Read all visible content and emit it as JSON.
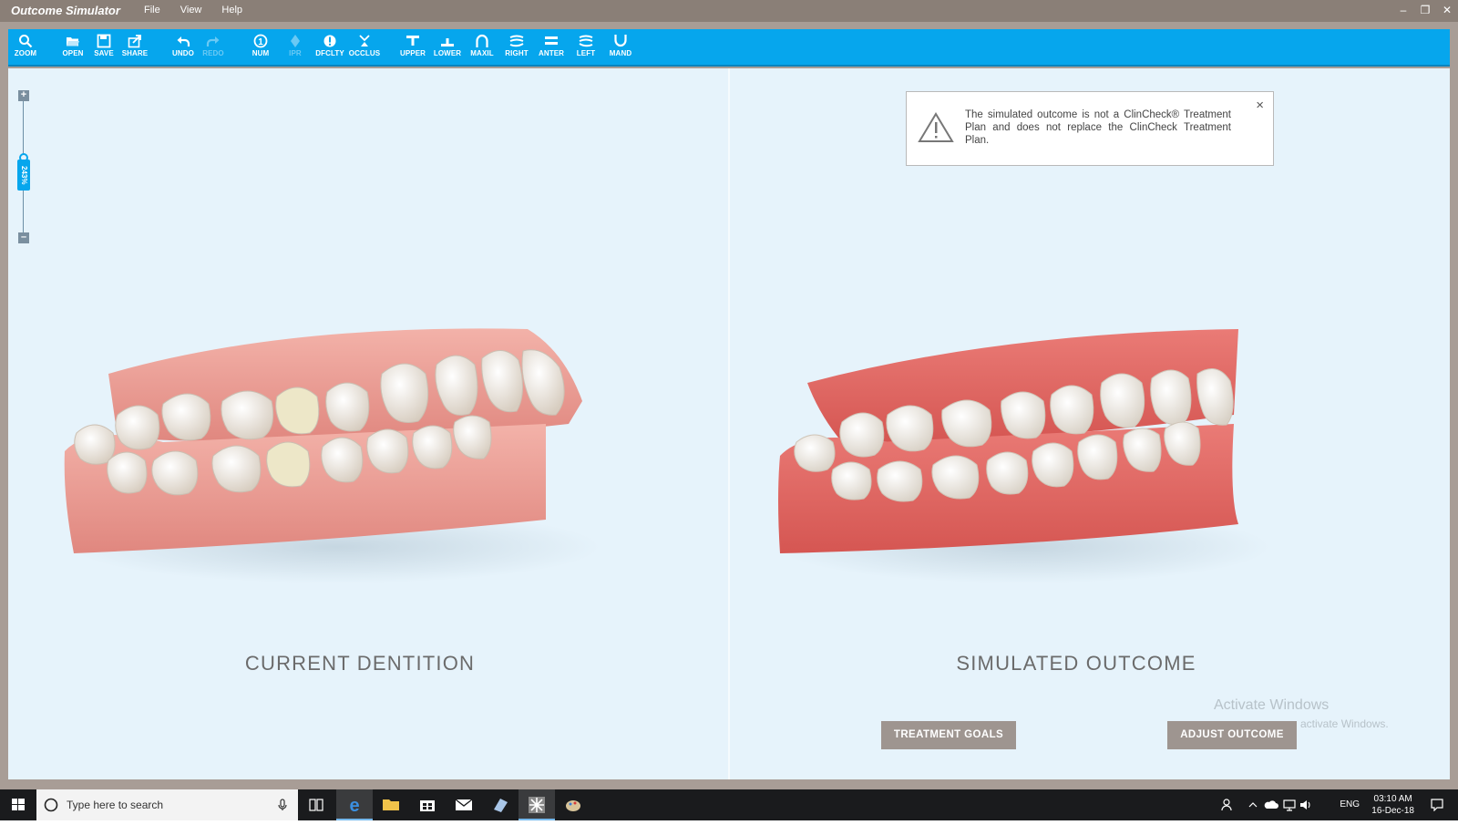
{
  "window": {
    "title": "Outcome Simulator",
    "menu": [
      "File",
      "View",
      "Help"
    ]
  },
  "toolbar": {
    "tools": [
      {
        "label": "ZOOM",
        "icon": "zoom-icon",
        "enabled": true
      },
      {
        "label": "OPEN",
        "icon": "open-folder-icon",
        "enabled": true
      },
      {
        "label": "SAVE",
        "icon": "save-icon",
        "enabled": true
      },
      {
        "label": "SHARE",
        "icon": "share-icon",
        "enabled": true
      },
      {
        "label": "UNDO",
        "icon": "undo-icon",
        "enabled": true
      },
      {
        "label": "REDO",
        "icon": "redo-icon",
        "enabled": false
      },
      {
        "label": "NUM",
        "icon": "number-icon",
        "enabled": true
      },
      {
        "label": "IPR",
        "icon": "ipr-icon",
        "enabled": false
      },
      {
        "label": "DFCLTY",
        "icon": "difficulty-icon",
        "enabled": true
      },
      {
        "label": "OCCLUS",
        "icon": "occlusion-icon",
        "enabled": true
      },
      {
        "label": "UPPER",
        "icon": "upper-view-icon",
        "enabled": true
      },
      {
        "label": "LOWER",
        "icon": "lower-view-icon",
        "enabled": true
      },
      {
        "label": "MAXIL",
        "icon": "maxillary-icon",
        "enabled": true
      },
      {
        "label": "RIGHT",
        "icon": "right-view-icon",
        "enabled": true
      },
      {
        "label": "ANTER",
        "icon": "anterior-view-icon",
        "enabled": true
      },
      {
        "label": "LEFT",
        "icon": "left-view-icon",
        "enabled": true
      },
      {
        "label": "MAND",
        "icon": "mandibular-icon",
        "enabled": true
      }
    ]
  },
  "zoom": {
    "value_label": "243%",
    "level": 0.33
  },
  "panels": {
    "left_title": "CURRENT DENTITION",
    "right_title": "SIMULATED OUTCOME"
  },
  "notice": {
    "text": "The simulated outcome is not a ClinCheck® Treatment Plan and does not replace the ClinCheck Treatment Plan.",
    "close": "×"
  },
  "buttons": {
    "treatment_goals": "TREATMENT GOALS",
    "adjust_outcome": "ADJUST OUTCOME"
  },
  "watermark": {
    "line1": "Activate Windows",
    "line2": "activate Windows."
  },
  "taskbar": {
    "search_placeholder": "Type here to search",
    "language": "ENG",
    "time": "03:10 AM",
    "date": "16-Dec-18"
  },
  "colors": {
    "accent": "#06a6ed",
    "workspace": "#e6f3fb",
    "button": "#9e9590",
    "gum_current": "#e8958f",
    "gum_simulated": "#d9615d"
  }
}
